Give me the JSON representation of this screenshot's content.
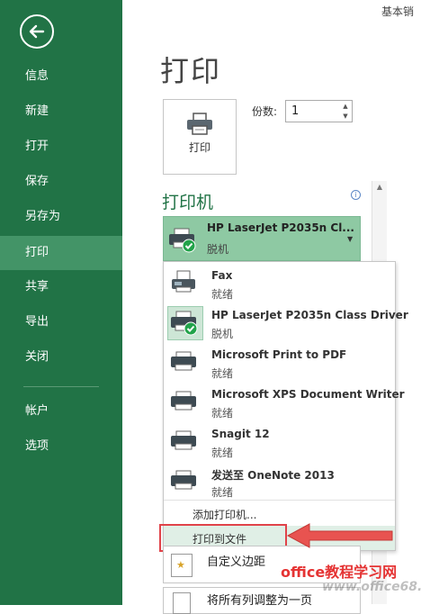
{
  "window": {
    "title": "基本销"
  },
  "sidebar": {
    "items": [
      {
        "label": "信息"
      },
      {
        "label": "新建"
      },
      {
        "label": "打开"
      },
      {
        "label": "保存"
      },
      {
        "label": "另存为"
      },
      {
        "label": "打印"
      },
      {
        "label": "共享"
      },
      {
        "label": "导出"
      },
      {
        "label": "关闭"
      },
      {
        "label": "帐户"
      },
      {
        "label": "选项"
      }
    ],
    "active": "打印"
  },
  "main": {
    "title": "打印",
    "print_button": {
      "label": "打印"
    },
    "copies": {
      "label": "份数:",
      "value": "1"
    },
    "printer_section": {
      "heading": "打印机"
    },
    "selected_printer": {
      "name": "HP LaserJet P2035n Cl...",
      "status": "脱机"
    },
    "dropdown": {
      "printers": [
        {
          "name": "Fax",
          "status": "就绪"
        },
        {
          "name": "HP LaserJet P2035n Class Driver",
          "status": "脱机"
        },
        {
          "name": "Microsoft Print to PDF",
          "status": "就绪"
        },
        {
          "name": "Microsoft XPS Document Writer",
          "status": "就绪"
        },
        {
          "name": "Snagit 12",
          "status": "就绪"
        },
        {
          "name": "发送至 OneNote 2013",
          "status": "就绪"
        }
      ],
      "add_printer": "添加打印机...",
      "print_to_file": "打印到文件"
    },
    "margins": {
      "label": "自定义边距"
    },
    "scaling": {
      "label": "将所有列调整为一页"
    }
  },
  "watermark": {
    "text": "office教程学习网",
    "url": "www.office68.com"
  },
  "colors": {
    "sidebar": "#217346",
    "active_item": "#439467",
    "accent": "#217346",
    "highlight": "#e0434a"
  }
}
